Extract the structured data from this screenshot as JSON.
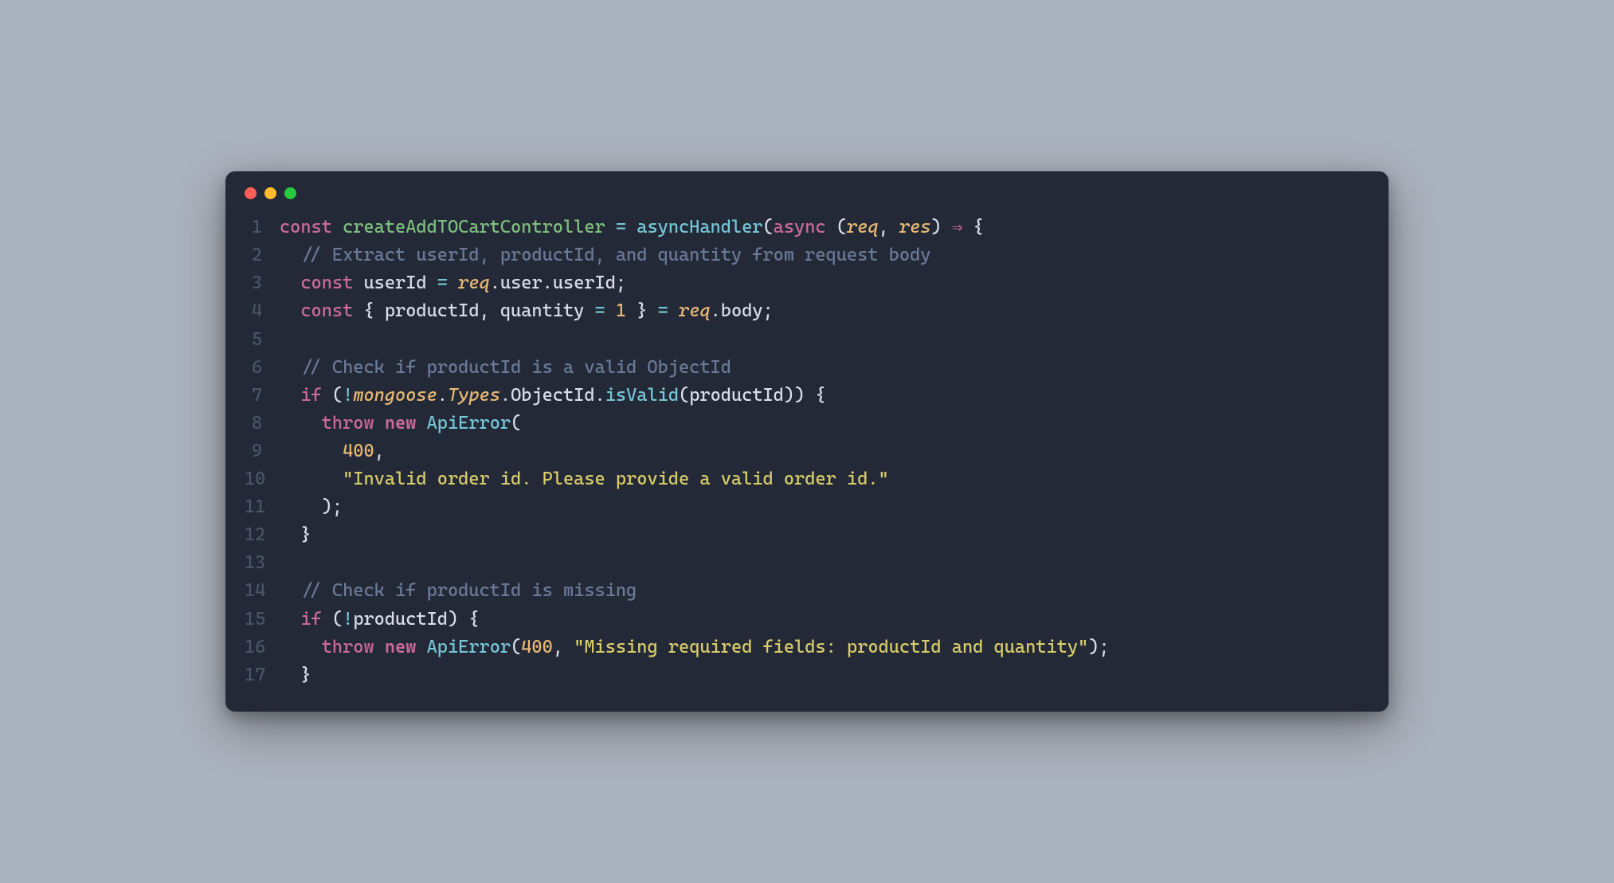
{
  "window": {
    "trafficLights": [
      "red",
      "yellow",
      "green"
    ]
  },
  "code": {
    "lines": [
      {
        "n": "1",
        "tokens": [
          {
            "cls": "tok-keyword",
            "t": "const "
          },
          {
            "cls": "tok-func-name",
            "t": "createAddTOCartController"
          },
          {
            "cls": "tok-punct",
            "t": " "
          },
          {
            "cls": "tok-operator",
            "t": "="
          },
          {
            "cls": "tok-punct",
            "t": " "
          },
          {
            "cls": "tok-call",
            "t": "asyncHandler"
          },
          {
            "cls": "tok-punct",
            "t": "("
          },
          {
            "cls": "tok-keyword",
            "t": "async"
          },
          {
            "cls": "tok-punct",
            "t": " ("
          },
          {
            "cls": "tok-param",
            "t": "req"
          },
          {
            "cls": "tok-punct",
            "t": ", "
          },
          {
            "cls": "tok-param",
            "t": "res"
          },
          {
            "cls": "tok-punct",
            "t": ") "
          },
          {
            "cls": "tok-arrow",
            "t": "⇒"
          },
          {
            "cls": "tok-punct",
            "t": " {"
          }
        ]
      },
      {
        "n": "2",
        "tokens": [
          {
            "cls": "tok-comment",
            "t": "  // Extract userId, productId, and quantity from request body"
          }
        ]
      },
      {
        "n": "3",
        "tokens": [
          {
            "cls": "tok-punct",
            "t": "  "
          },
          {
            "cls": "tok-keyword",
            "t": "const "
          },
          {
            "cls": "tok-ident",
            "t": "userId "
          },
          {
            "cls": "tok-operator",
            "t": "="
          },
          {
            "cls": "tok-punct",
            "t": " "
          },
          {
            "cls": "tok-italic-ident",
            "t": "req"
          },
          {
            "cls": "tok-punct",
            "t": ".user.userId;"
          }
        ]
      },
      {
        "n": "4",
        "tokens": [
          {
            "cls": "tok-punct",
            "t": "  "
          },
          {
            "cls": "tok-keyword",
            "t": "const "
          },
          {
            "cls": "tok-punct",
            "t": "{ productId, quantity "
          },
          {
            "cls": "tok-operator",
            "t": "="
          },
          {
            "cls": "tok-punct",
            "t": " "
          },
          {
            "cls": "tok-number",
            "t": "1"
          },
          {
            "cls": "tok-punct",
            "t": " } "
          },
          {
            "cls": "tok-operator",
            "t": "="
          },
          {
            "cls": "tok-punct",
            "t": " "
          },
          {
            "cls": "tok-italic-ident",
            "t": "req"
          },
          {
            "cls": "tok-punct",
            "t": ".body;"
          }
        ]
      },
      {
        "n": "5",
        "tokens": [
          {
            "cls": "tok-punct",
            "t": ""
          }
        ]
      },
      {
        "n": "6",
        "tokens": [
          {
            "cls": "tok-comment",
            "t": "  // Check if productId is a valid ObjectId"
          }
        ]
      },
      {
        "n": "7",
        "tokens": [
          {
            "cls": "tok-punct",
            "t": "  "
          },
          {
            "cls": "tok-keyword",
            "t": "if"
          },
          {
            "cls": "tok-punct",
            "t": " ("
          },
          {
            "cls": "tok-operator",
            "t": "!"
          },
          {
            "cls": "tok-italic-ident",
            "t": "mongoose"
          },
          {
            "cls": "tok-punct",
            "t": "."
          },
          {
            "cls": "tok-italic-ident",
            "t": "Types"
          },
          {
            "cls": "tok-punct",
            "t": ".ObjectId."
          },
          {
            "cls": "tok-call",
            "t": "isValid"
          },
          {
            "cls": "tok-punct",
            "t": "(productId)) {"
          }
        ]
      },
      {
        "n": "8",
        "tokens": [
          {
            "cls": "tok-punct",
            "t": "    "
          },
          {
            "cls": "tok-keyword",
            "t": "throw"
          },
          {
            "cls": "tok-punct",
            "t": " "
          },
          {
            "cls": "tok-keyword-bold",
            "t": "new"
          },
          {
            "cls": "tok-punct",
            "t": " "
          },
          {
            "cls": "tok-class",
            "t": "ApiError"
          },
          {
            "cls": "tok-punct",
            "t": "("
          }
        ]
      },
      {
        "n": "9",
        "tokens": [
          {
            "cls": "tok-punct",
            "t": "      "
          },
          {
            "cls": "tok-number",
            "t": "400"
          },
          {
            "cls": "tok-punct",
            "t": ","
          }
        ]
      },
      {
        "n": "10",
        "tokens": [
          {
            "cls": "tok-punct",
            "t": "      "
          },
          {
            "cls": "tok-string",
            "t": "\"Invalid order id. Please provide a valid order id.\""
          }
        ]
      },
      {
        "n": "11",
        "tokens": [
          {
            "cls": "tok-punct",
            "t": "    );"
          }
        ]
      },
      {
        "n": "12",
        "tokens": [
          {
            "cls": "tok-punct",
            "t": "  }"
          }
        ]
      },
      {
        "n": "13",
        "tokens": [
          {
            "cls": "tok-punct",
            "t": ""
          }
        ]
      },
      {
        "n": "14",
        "tokens": [
          {
            "cls": "tok-comment",
            "t": "  // Check if productId is missing"
          }
        ]
      },
      {
        "n": "15",
        "tokens": [
          {
            "cls": "tok-punct",
            "t": "  "
          },
          {
            "cls": "tok-keyword",
            "t": "if"
          },
          {
            "cls": "tok-punct",
            "t": " ("
          },
          {
            "cls": "tok-operator",
            "t": "!"
          },
          {
            "cls": "tok-punct",
            "t": "productId) {"
          }
        ]
      },
      {
        "n": "16",
        "tokens": [
          {
            "cls": "tok-punct",
            "t": "    "
          },
          {
            "cls": "tok-keyword",
            "t": "throw"
          },
          {
            "cls": "tok-punct",
            "t": " "
          },
          {
            "cls": "tok-keyword-bold",
            "t": "new"
          },
          {
            "cls": "tok-punct",
            "t": " "
          },
          {
            "cls": "tok-class",
            "t": "ApiError"
          },
          {
            "cls": "tok-punct",
            "t": "("
          },
          {
            "cls": "tok-number",
            "t": "400"
          },
          {
            "cls": "tok-punct",
            "t": ", "
          },
          {
            "cls": "tok-string",
            "t": "\"Missing required fields: productId and quantity\""
          },
          {
            "cls": "tok-punct",
            "t": ");"
          }
        ]
      },
      {
        "n": "17",
        "tokens": [
          {
            "cls": "tok-punct",
            "t": "  }"
          }
        ]
      }
    ]
  }
}
